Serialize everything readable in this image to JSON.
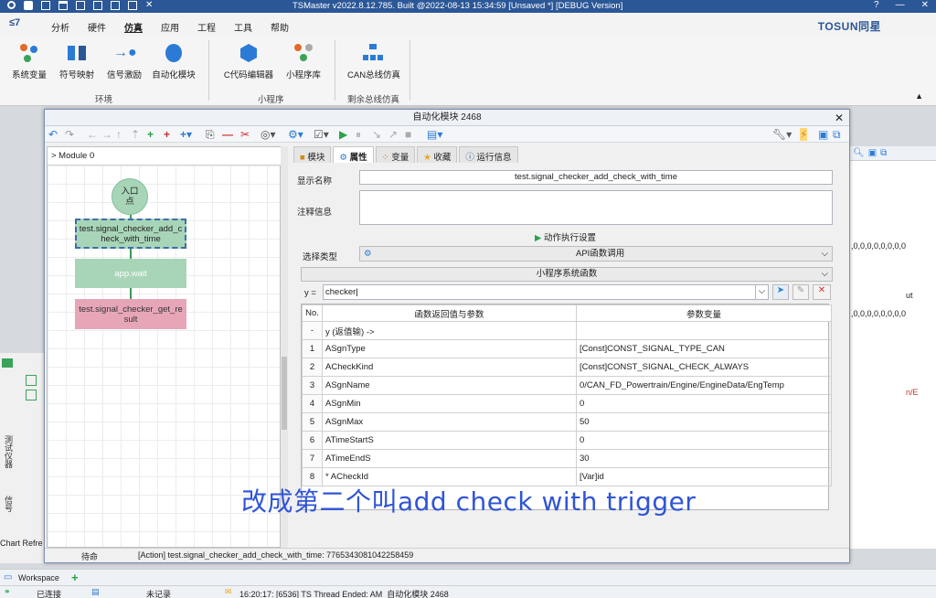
{
  "titlebar": {
    "title": "TSMaster v2022.8.12.785. Built @2022-08-13 15:34:59 [Unsaved *] [DEBUG Version]",
    "help": "?",
    "minimize": "—",
    "close": "✕"
  },
  "menubar": {
    "logo": "≤7",
    "menus": [
      "分析",
      "硬件",
      "仿真",
      "应用",
      "工程",
      "工具",
      "帮助"
    ],
    "active_menu": "仿真",
    "brand": "TOSUN同星"
  },
  "ribbon": {
    "buttons": [
      "系统变量",
      "符号映射",
      "信号激励",
      "自动化模块",
      "C代码编辑器",
      "小程序库",
      "CAN总线仿真"
    ],
    "groups": [
      "环境",
      "小程序",
      "剩余总线仿真"
    ]
  },
  "dialog": {
    "title": "自动化模块 2468",
    "module_header": "> Module 0",
    "nodes": {
      "start": "入口\n点",
      "selected": "test.signal_checker_add_check_with_time",
      "wait": "app.wait",
      "get": "test.signal_checker_get_result"
    },
    "tabs": [
      "模块",
      "属性",
      "变量",
      "收藏",
      "运行信息"
    ],
    "active_tab": "属性",
    "display_name_label": "显示名称",
    "display_name_value": "test.signal_checker_add_check_with_time",
    "comment_label": "注释信息",
    "action_settings": "动作执行设置",
    "select_type_label": "选择类型",
    "select_type_value": "API函数调用",
    "library_header": "小程序系统函数",
    "y_label": "y =",
    "y_value": "checker",
    "grid": {
      "headers": [
        "No.",
        "函数返回值与参数",
        "参数变量"
      ],
      "return_row": [
        "-",
        "y (返值输) ->",
        ""
      ],
      "rows": [
        [
          "1",
          "ASgnType",
          "[Const]CONST_SIGNAL_TYPE_CAN"
        ],
        [
          "2",
          "ACheckKind",
          "[Const]CONST_SIGNAL_CHECK_ALWAYS"
        ],
        [
          "3",
          "ASgnName",
          "0/CAN_FD_Powertrain/Engine/EngineData/EngTemp"
        ],
        [
          "4",
          "ASgnMin",
          "0"
        ],
        [
          "5",
          "ASgnMax",
          "50"
        ],
        [
          "6",
          "ATimeStartS",
          "0"
        ],
        [
          "7",
          "ATimeEndS",
          "30"
        ],
        [
          "8",
          "* ACheckId",
          "[Var]id"
        ]
      ]
    },
    "status_left": "待命",
    "status_action": "[Action] test.signal_checker_add_check_with_time: 7765343081042258459"
  },
  "subtitle": "改成第二个叫add check with trigger",
  "right_panel": {
    "line1": ",0,0,0,0,0,0,0,0",
    "line2": ",0,0,0,0,0,0,0,0",
    "out": "ut",
    "ret": "n/E"
  },
  "left_panel": {
    "vtext1": "测试仪器",
    "vtext2": "信号",
    "chart_ref": "Chart Refre"
  },
  "workspace": {
    "label": "Workspace",
    "add": "+"
  },
  "statusbar": {
    "connected": "已连接",
    "record": "未记录",
    "message": "16:20:17: [6536] TS Thread Ended: AM_自动化模块 2468"
  },
  "colors": {
    "titlebar": "#2b5797",
    "node_green": "#a8d5b8",
    "node_pink": "#e7a6b8",
    "subtitle": "#2f54d6"
  }
}
